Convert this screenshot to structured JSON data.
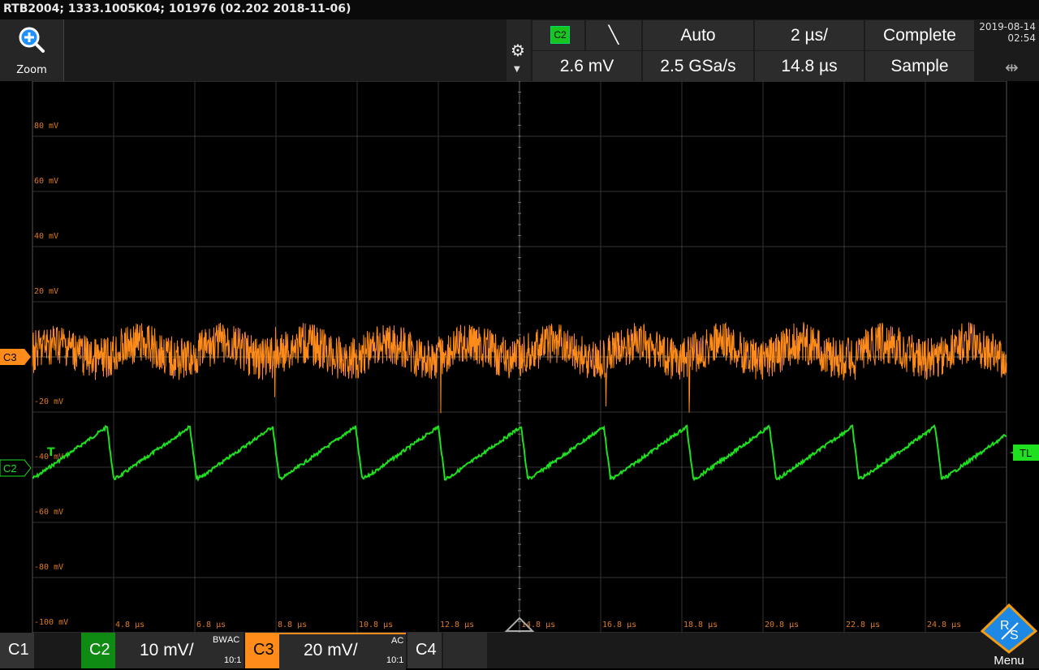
{
  "title": "RTB2004; 1333.1005K04; 101976 (02.202 2018-11-06)",
  "zoom": {
    "label": "Zoom"
  },
  "trigger_panel": {
    "source": "C2",
    "edge": "╲",
    "mode": "Auto",
    "timebase": "2 µs/",
    "acquisition": "Complete",
    "level": "2.6 mV",
    "sample_rate": "2.5 GSa/s",
    "position": "14.8 µs",
    "acq_mode": "Sample"
  },
  "datetime": {
    "date": "2019-08-14",
    "time": "02:54"
  },
  "icons": {
    "zoom": "zoom-in-icon",
    "settings": "gear-icon",
    "usb": "usb-icon"
  },
  "colors": {
    "c2": "#1ee01e",
    "c3": "#ff8c1a",
    "grid": "#3a3a3a",
    "axis_label": "#e07a20"
  },
  "screen": {
    "y_labels": [
      "80 mV",
      "60 mV",
      "40 mV",
      "20 mV",
      "-20 mV",
      "-40 mV",
      "-60 mV",
      "-80 mV",
      "-100 mV"
    ],
    "x_labels": [
      "4.8 µs",
      "6.8 µs",
      "8.8 µs",
      "10.8 µs",
      "12.8 µs",
      "14.8 µs",
      "16.8 µs",
      "18.8 µs",
      "20.8 µs",
      "22.8 µs",
      "24.8 µs"
    ],
    "c3_marker": "C3",
    "c2_marker": "C2",
    "trigger_marker": "T",
    "trigger_level_marker": "TL"
  },
  "bottom": {
    "c1": {
      "name": "C1"
    },
    "c2": {
      "name": "C2",
      "scale": "10 mV/",
      "bw": "BW",
      "coupling": "AC",
      "probe": "10:1"
    },
    "c3": {
      "name": "C3",
      "scale": "20 mV/",
      "coupling": "AC",
      "probe": "10:1"
    },
    "c4": {
      "name": "C4"
    },
    "menu": "Menu"
  }
}
